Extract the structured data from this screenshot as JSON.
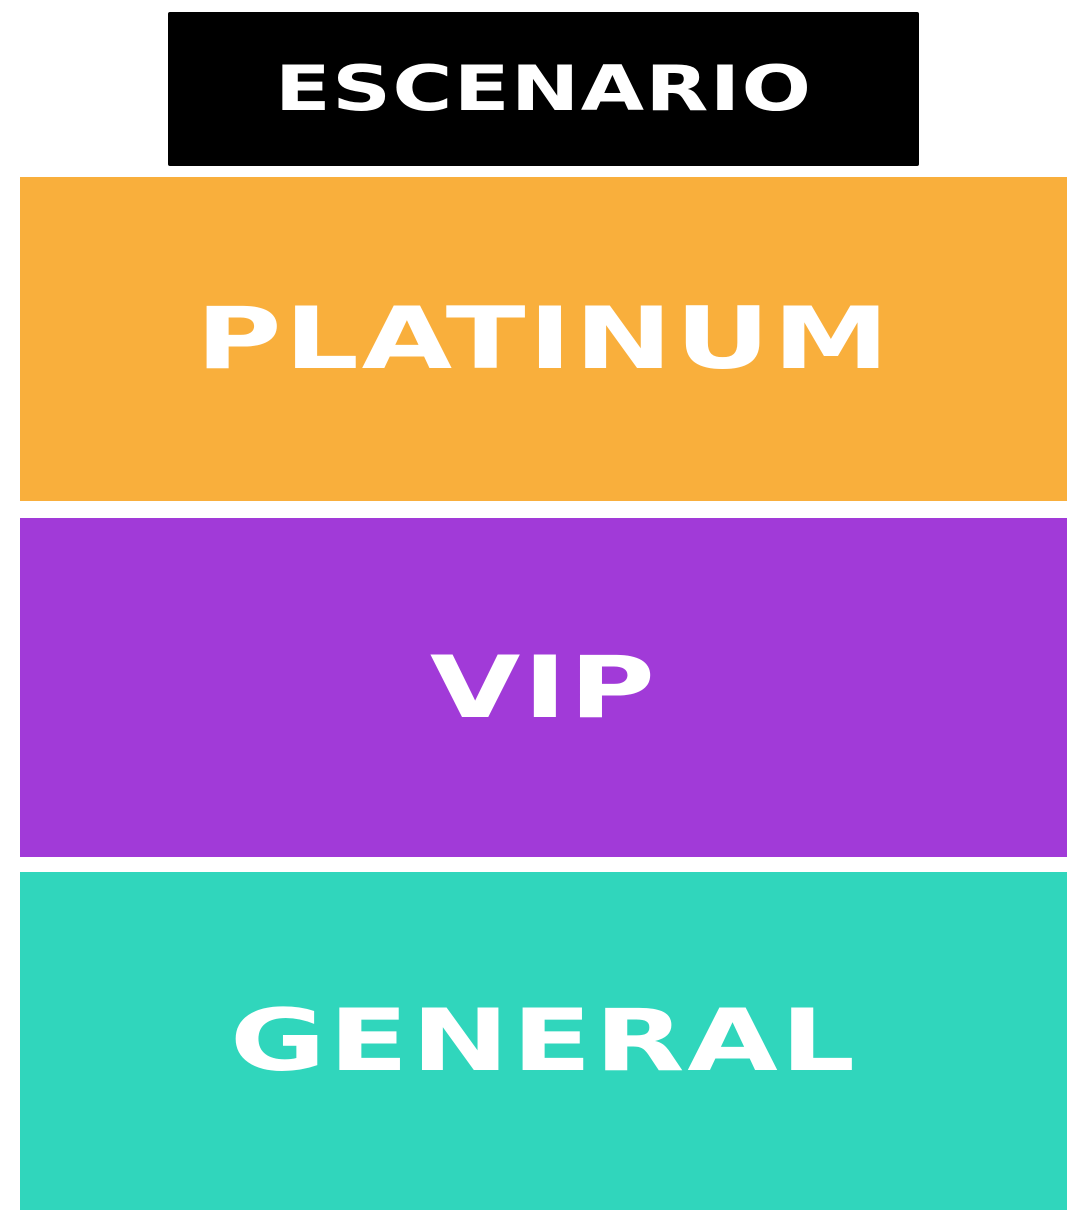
{
  "stage": {
    "label": "ESCENARIO",
    "color": "#000000"
  },
  "zones": [
    {
      "label": "PLATINUM",
      "color": "#F9AF3C"
    },
    {
      "label": "VIP",
      "color": "#A13AD8"
    },
    {
      "label": "GENERAL",
      "color": "#30D6BC"
    }
  ],
  "text_color": "#FFFFFF"
}
